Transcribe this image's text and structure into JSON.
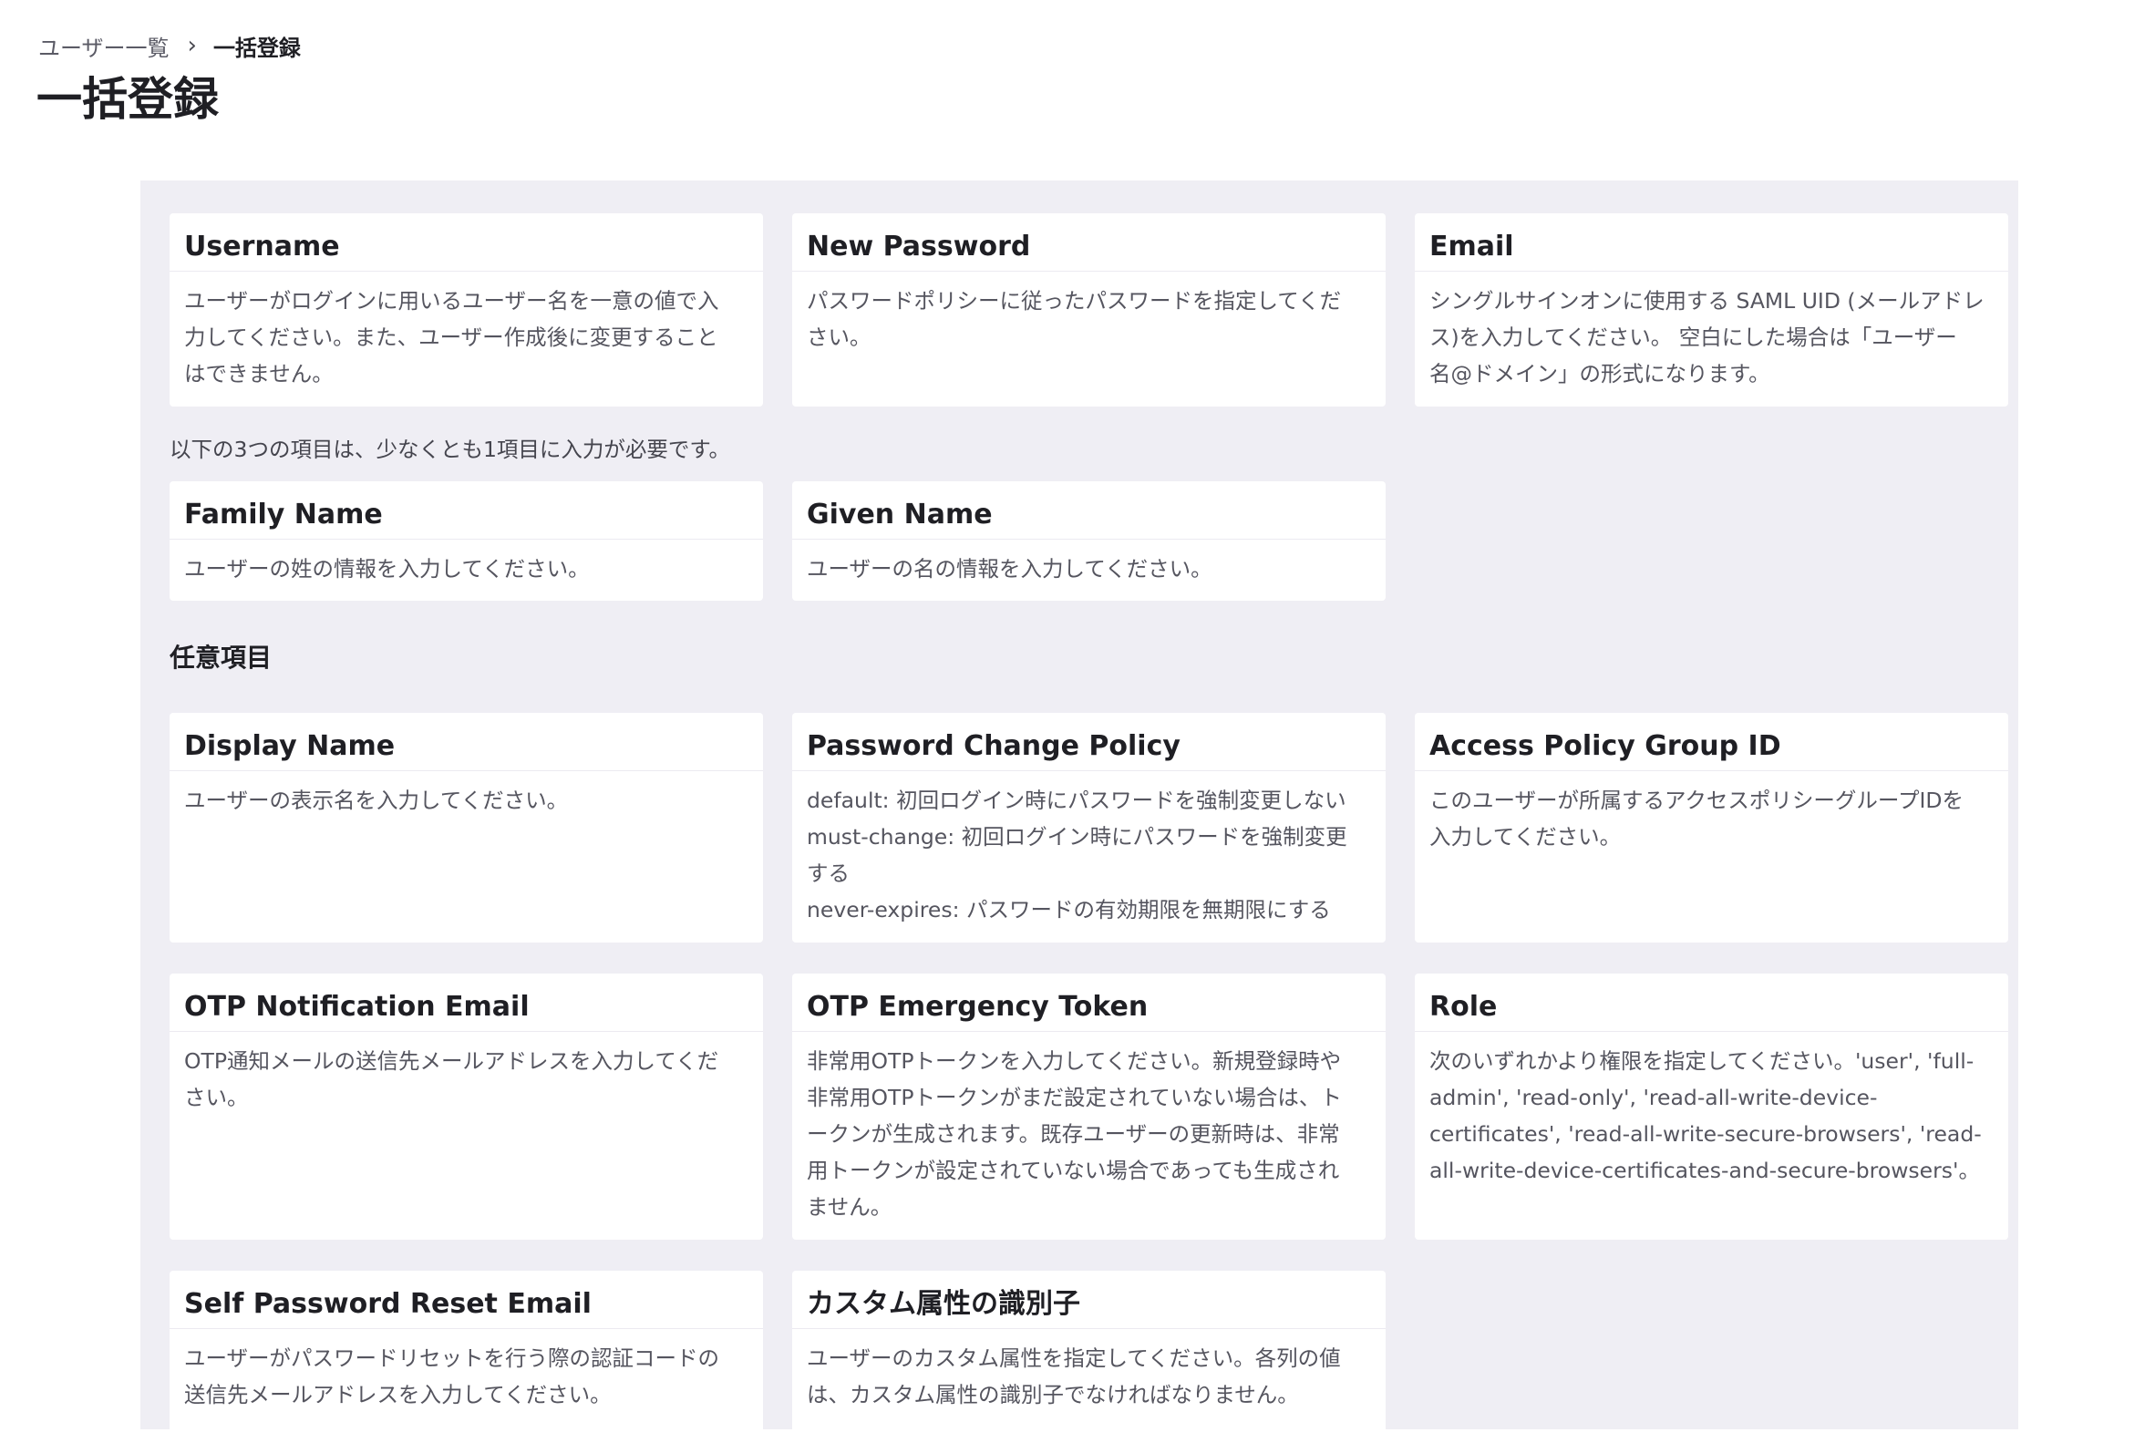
{
  "breadcrumb": {
    "parent": "ユーザー一覧",
    "separator": "›",
    "current": "一括登録"
  },
  "page_title": "一括登録",
  "required_cards": [
    {
      "title": "Username",
      "description": "ユーザーがログインに用いるユーザー名を一意の値で入\n力してください。また、ユーザー作成後に変更すること\nはできません。"
    },
    {
      "title": "New Password",
      "description": "パスワードポリシーに従ったパスワードを指定してくだ\nさい。"
    },
    {
      "title": "Email",
      "description": "シングルサインオンに使用する SAML UID (メールアドレ\nス)を入力してください。 空白にした場合は「ユーザー\n名@ドメイン」の形式になります。"
    }
  ],
  "name_note": "以下の3つの項目は、少なくとも1項目に入力が必要です。",
  "name_cards": [
    {
      "title": "Family Name",
      "description": "ユーザーの姓の情報を入力してください。"
    },
    {
      "title": "Given Name",
      "description": "ユーザーの名の情報を入力してください。"
    }
  ],
  "optional_heading": "任意項目",
  "optional_cards": [
    {
      "title": "Display Name",
      "description": "ユーザーの表示名を入力してください。"
    },
    {
      "title": "Password Change Policy",
      "description": "default: 初回ログイン時にパスワードを強制変更しない\nmust-change: 初回ログイン時にパスワードを強制変更\nする\nnever-expires: パスワードの有効期限を無期限にする"
    },
    {
      "title": "Access Policy Group ID",
      "description": "このユーザーが所属するアクセスポリシーグループIDを\n入力してください。"
    },
    {
      "title": "OTP Notification Email",
      "description": "OTP通知メールの送信先メールアドレスを入力してくだ\nさい。"
    },
    {
      "title": "OTP Emergency Token",
      "description": "非常用OTPトークンを入力してください。新規登録時や\n非常用OTPトークンがまだ設定されていない場合は、ト\nークンが生成されます。既存ユーザーの更新時は、非常\n用トークンが設定されていない場合であっても生成され\nません。"
    },
    {
      "title": "Role",
      "description": "次のいずれかより権限を指定してください。'user', 'full-\nadmin', 'read-only', 'read-all-write-device-\ncertificates', 'read-all-write-secure-browsers', 'read-\nall-write-device-certificates-and-secure-browsers'。"
    },
    {
      "title": "Self Password Reset Email",
      "description": "ユーザーがパスワードリセットを行う際の認証コードの\n送信先メールアドレスを入力してください。"
    },
    {
      "title": "カスタム属性の識別子",
      "description": "ユーザーのカスタム属性を指定してください。各列の値\nは、カスタム属性の識別子でなければなりません。"
    }
  ]
}
